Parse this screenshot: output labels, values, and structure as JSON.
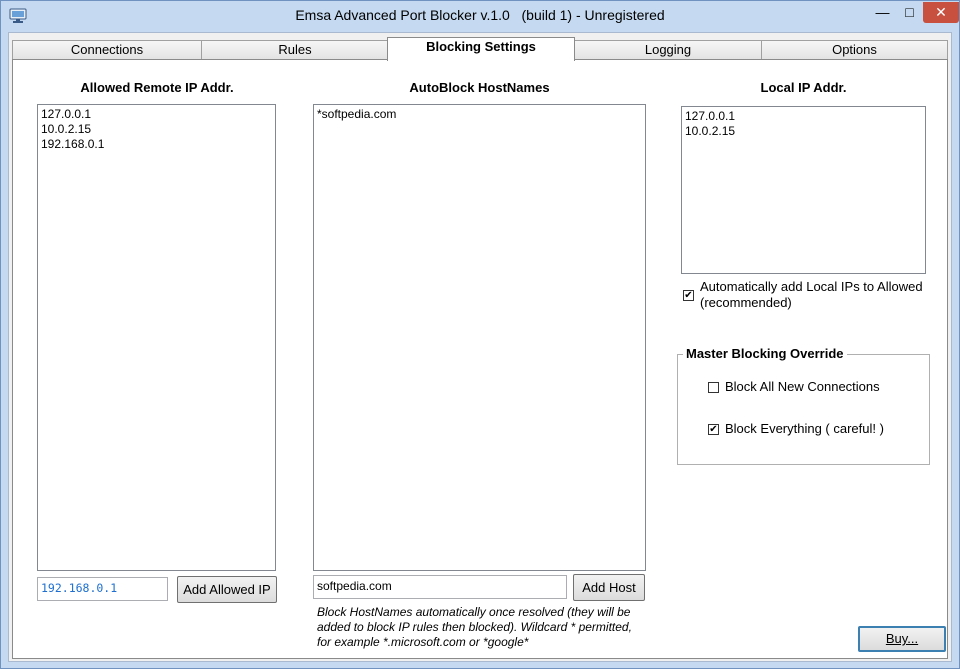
{
  "window": {
    "title": "Emsa Advanced Port Blocker v.1.0   (build 1) - Unregistered",
    "minimize_glyph": "—",
    "maximize_glyph": "□",
    "close_glyph": "✕"
  },
  "tabs": [
    {
      "label": "Connections",
      "active": false
    },
    {
      "label": "Rules",
      "active": false
    },
    {
      "label": "Blocking Settings",
      "active": true
    },
    {
      "label": "Logging",
      "active": false
    },
    {
      "label": "Options",
      "active": false
    }
  ],
  "allowed_remote": {
    "header": "Allowed Remote IP Addr.",
    "items": [
      "127.0.0.1",
      "10.0.2.15",
      "192.168.0.1"
    ],
    "input_value": "192.168.0.1",
    "add_button": "Add Allowed IP"
  },
  "autoblock": {
    "header": "AutoBlock HostNames",
    "items": [
      "*softpedia.com"
    ],
    "input_value": "softpedia.com",
    "add_button": "Add Host",
    "hint_line1": "Block HostNames automatically once resolved (they will be",
    "hint_line2": "added to block IP rules then blocked). Wildcard * permitted,",
    "hint_line3": "for example *.microsoft.com or *google*"
  },
  "local_ip": {
    "header": "Local IP Addr.",
    "items": [
      "127.0.0.1",
      "10.0.2.15"
    ],
    "auto_add_line1": "Automatically add Local IPs to Allowed",
    "auto_add_line2": "(recommended)",
    "auto_add_checked": true
  },
  "master_override": {
    "title": "Master Blocking Override",
    "block_new_label": "Block All New Connections",
    "block_new_checked": false,
    "block_everything_label": "Block Everything ( careful! )",
    "block_everything_checked": true
  },
  "buy_button": "Buy...",
  "check_glyph": "✔",
  "colors": {
    "title_bar": "#c5daf1",
    "close_button": "#c7503f",
    "input_text": "#1e6fd0"
  }
}
